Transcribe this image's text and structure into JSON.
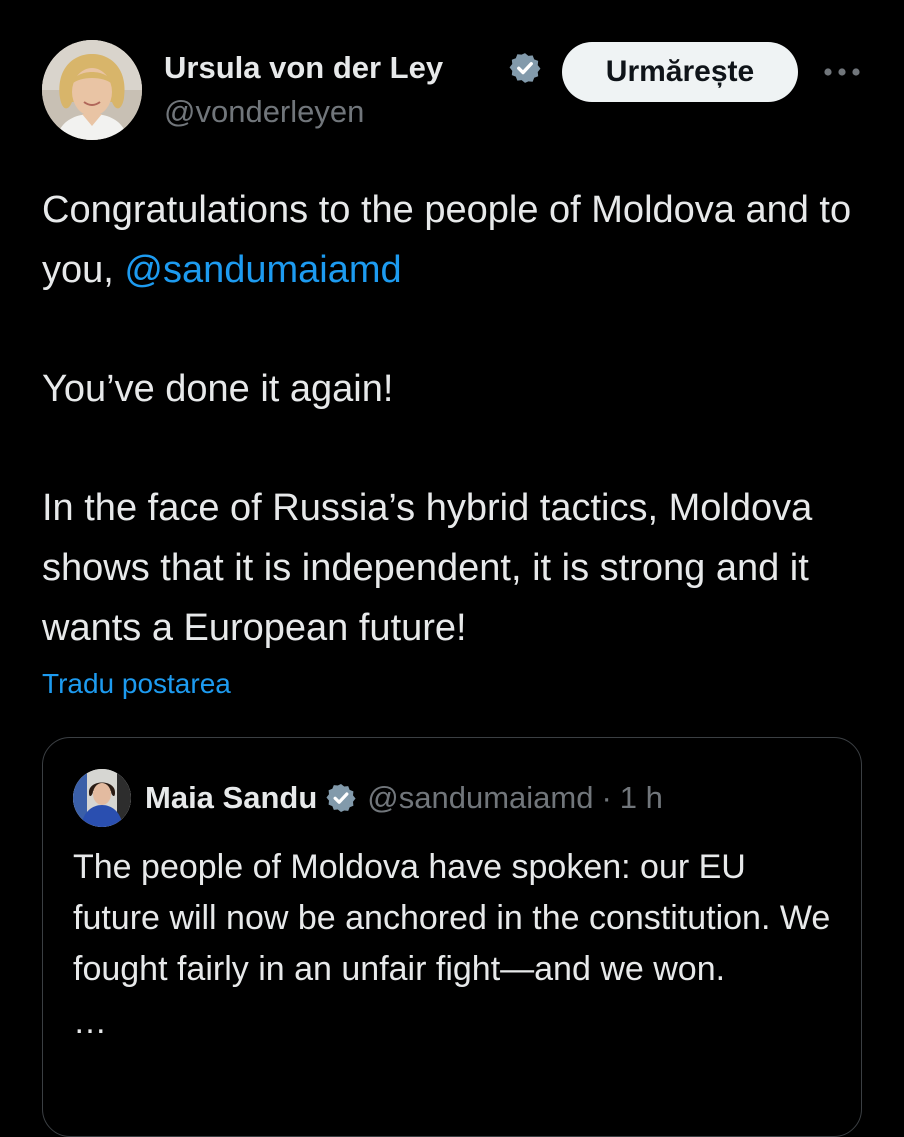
{
  "author": {
    "display_name": "Ursula von der Ley",
    "handle": "@vonderleyen",
    "verified_icon": "verified-badge-icon",
    "avatar_alt": "avatar"
  },
  "actions": {
    "follow_label": "Urmărește",
    "more_icon": "more-options-icon"
  },
  "post": {
    "line1_prefix": "Congratulations to the people of Moldova and to you, ",
    "line1_mention": "@sandumaiamd",
    "paragraph2": "You’ve done it again!",
    "paragraph3": "In the face of Russia’s hybrid tactics, Moldova shows that it is independent, it is strong and it wants a European future!",
    "translate_label": "Tradu postarea"
  },
  "quoted": {
    "display_name": "Maia Sandu",
    "handle": "@sandumaiamd",
    "separator": "·",
    "time": "1 h",
    "text": "The people of Moldova have spoken: our EU future will now be anchored in the constitution. We fought fairly in an unfair fight—and we won.",
    "truncation": "…"
  },
  "colors": {
    "background": "#000000",
    "text": "#e7e9ea",
    "secondary": "#71767b",
    "link": "#1d9bf0",
    "verified": "#829aab",
    "border": "#3b3f43"
  }
}
